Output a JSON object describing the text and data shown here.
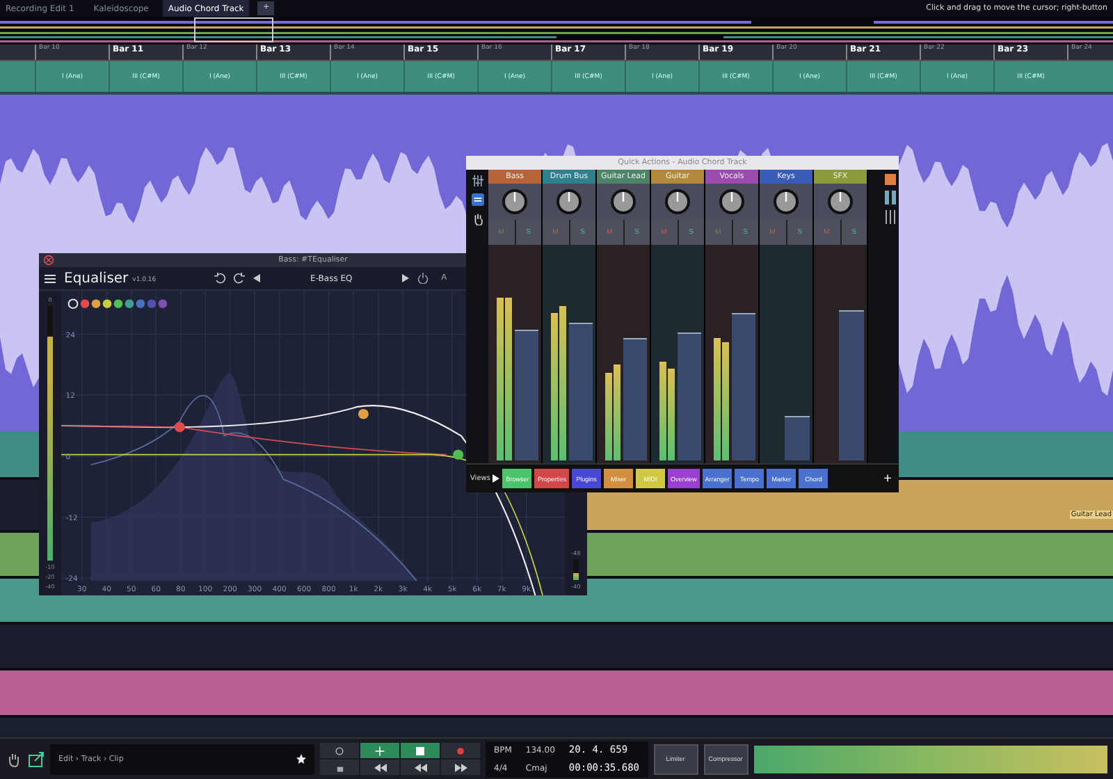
{
  "tabs": [
    {
      "label": "Recording Edit 1",
      "selected": false
    },
    {
      "label": "Kaleidoscope",
      "selected": false
    },
    {
      "label": "Audio Chord Track",
      "selected": true
    }
  ],
  "add_tab": "+",
  "hint": "Click and drag to move the cursor; right-button",
  "ruler": [
    {
      "label": "Bar 10",
      "major": false
    },
    {
      "label": "Bar 11",
      "major": true
    },
    {
      "label": "Bar 12",
      "major": false
    },
    {
      "label": "Bar 13",
      "major": true
    },
    {
      "label": "Bar 14",
      "major": false
    },
    {
      "label": "Bar 15",
      "major": true
    },
    {
      "label": "Bar 16",
      "major": false
    },
    {
      "label": "Bar 17",
      "major": true
    },
    {
      "label": "Bar 18",
      "major": false
    },
    {
      "label": "Bar 19",
      "major": true
    },
    {
      "label": "Bar 20",
      "major": false
    },
    {
      "label": "Bar 21",
      "major": true
    },
    {
      "label": "Bar 22",
      "major": false
    },
    {
      "label": "Bar 23",
      "major": true
    },
    {
      "label": "Bar 24",
      "major": false
    }
  ],
  "chords": [
    "I (Ane)",
    "III (C#M)",
    "I (Ane)",
    "III (C#M)",
    "I (Ane)",
    "III (C#M)",
    "I (Ane)",
    "III (C#M)",
    "I (Ane)",
    "III (C#M)",
    "I (Ane)",
    "III (C#M)",
    "I (Ane)",
    "III (C#M)"
  ],
  "lanes": [
    {
      "kind": "full",
      "color": "#3f8d86"
    },
    {
      "kind": "right",
      "color": "#c9a45a",
      "clip_label": "Guitar Lead"
    },
    {
      "kind": "full",
      "color": "#6fa35a"
    },
    {
      "kind": "full",
      "color": "#4a9a8c"
    },
    {
      "kind": "empty",
      "color": "#1c1d2e"
    },
    {
      "kind": "full",
      "color": "#b85f93"
    },
    {
      "kind": "empty",
      "color": "#1a2030"
    }
  ],
  "eq": {
    "title": "Bass: #TEqualiser",
    "name": "Equaliser",
    "version": "v1.0.16",
    "preset": "E-Bass EQ",
    "a_button": "A",
    "bands": [
      {
        "color": "#e04a4a"
      },
      {
        "color": "#e0a040"
      },
      {
        "color": "#c8d040"
      },
      {
        "color": "#50c050"
      },
      {
        "color": "#40a090"
      },
      {
        "color": "#4a70c0"
      },
      {
        "color": "#5050b0"
      },
      {
        "color": "#8050b0"
      }
    ],
    "y_ticks": [
      "24",
      "12",
      "0",
      "-12",
      "-24"
    ],
    "x_ticks": [
      "30",
      "40",
      "50",
      "60",
      "80",
      "100",
      "200",
      "300",
      "400",
      "600",
      "800",
      "1k",
      "2k",
      "3k",
      "4k",
      "5k",
      "6k",
      "7k",
      "9k"
    ],
    "left_meter": {
      "labels": [
        "0",
        "-10",
        "-20",
        "-40"
      ],
      "level": 0.88
    },
    "right_meter": {
      "labels": [
        "-48",
        "-40"
      ],
      "level": 0.35
    }
  },
  "mixer": {
    "title": "Quick Actions - Audio Chord Track",
    "channels": [
      {
        "name": "Bass",
        "color": "#b8643a",
        "mute": "M",
        "solo": "S",
        "meters": [
          {
            "level": 0.75
          },
          {
            "level": 0.75
          }
        ],
        "fader": {
          "level": 0.6
        }
      },
      {
        "name": "Drum Bus",
        "color": "#2f7f8e",
        "mute": "M",
        "solo": "S",
        "meters": [
          {
            "level": 0.68
          },
          {
            "level": 0.71
          }
        ],
        "fader": {
          "level": 0.63
        }
      },
      {
        "name": "Guitar Lead",
        "color": "#4d8468",
        "mute": "M",
        "solo": "S",
        "meters": [
          {
            "level": 0.4
          },
          {
            "level": 0.44
          }
        ],
        "fader": {
          "level": 0.56
        }
      },
      {
        "name": "Guitar",
        "color": "#b08a3a",
        "mute": "M",
        "solo": "S",
        "meters": [
          {
            "level": 0.45
          },
          {
            "level": 0.42
          }
        ],
        "fader": {
          "level": 0.59
        }
      },
      {
        "name": "Vocals",
        "color": "#9a4cb0",
        "mute": "M",
        "solo": "S",
        "meters": [
          {
            "level": 0.56
          },
          {
            "level": 0.54
          }
        ],
        "fader": {
          "level": 0.68
        }
      },
      {
        "name": "Keys",
        "color": "#3a5ab8",
        "mute": "M",
        "solo": "S",
        "fader": {
          "level": 0.2
        }
      },
      {
        "name": "SFX",
        "color": "#8c9a3c",
        "mute": "M",
        "solo": "S",
        "fader": {
          "level": 0.69
        }
      }
    ],
    "views_label": "Views",
    "views": [
      {
        "label": "Browser",
        "color": "#4cc46a"
      },
      {
        "label": "Properties",
        "color": "#d04848"
      },
      {
        "label": "Plugins",
        "color": "#4848d8"
      },
      {
        "label": "Mixer",
        "color": "#d09040"
      },
      {
        "label": "MIDI",
        "color": "#d0c840"
      },
      {
        "label": "Overview",
        "color": "#9a40d0"
      },
      {
        "label": "Arranger",
        "color": "#4a70d0"
      },
      {
        "label": "Tempo",
        "color": "#4a70d0"
      },
      {
        "label": "Marker",
        "color": "#4a70d0"
      },
      {
        "label": "Chord",
        "color": "#4a70d0"
      }
    ],
    "add": "+"
  },
  "bottom": {
    "breadcrumb": "Edit › Track › Clip",
    "bpm_label": "BPM",
    "bpm": "134.00",
    "position": "20. 4. 659",
    "signature": "4/4",
    "key": "Cmaj",
    "time": "00:00:35.680",
    "plugins": [
      "Limiter",
      "Compressor"
    ]
  }
}
